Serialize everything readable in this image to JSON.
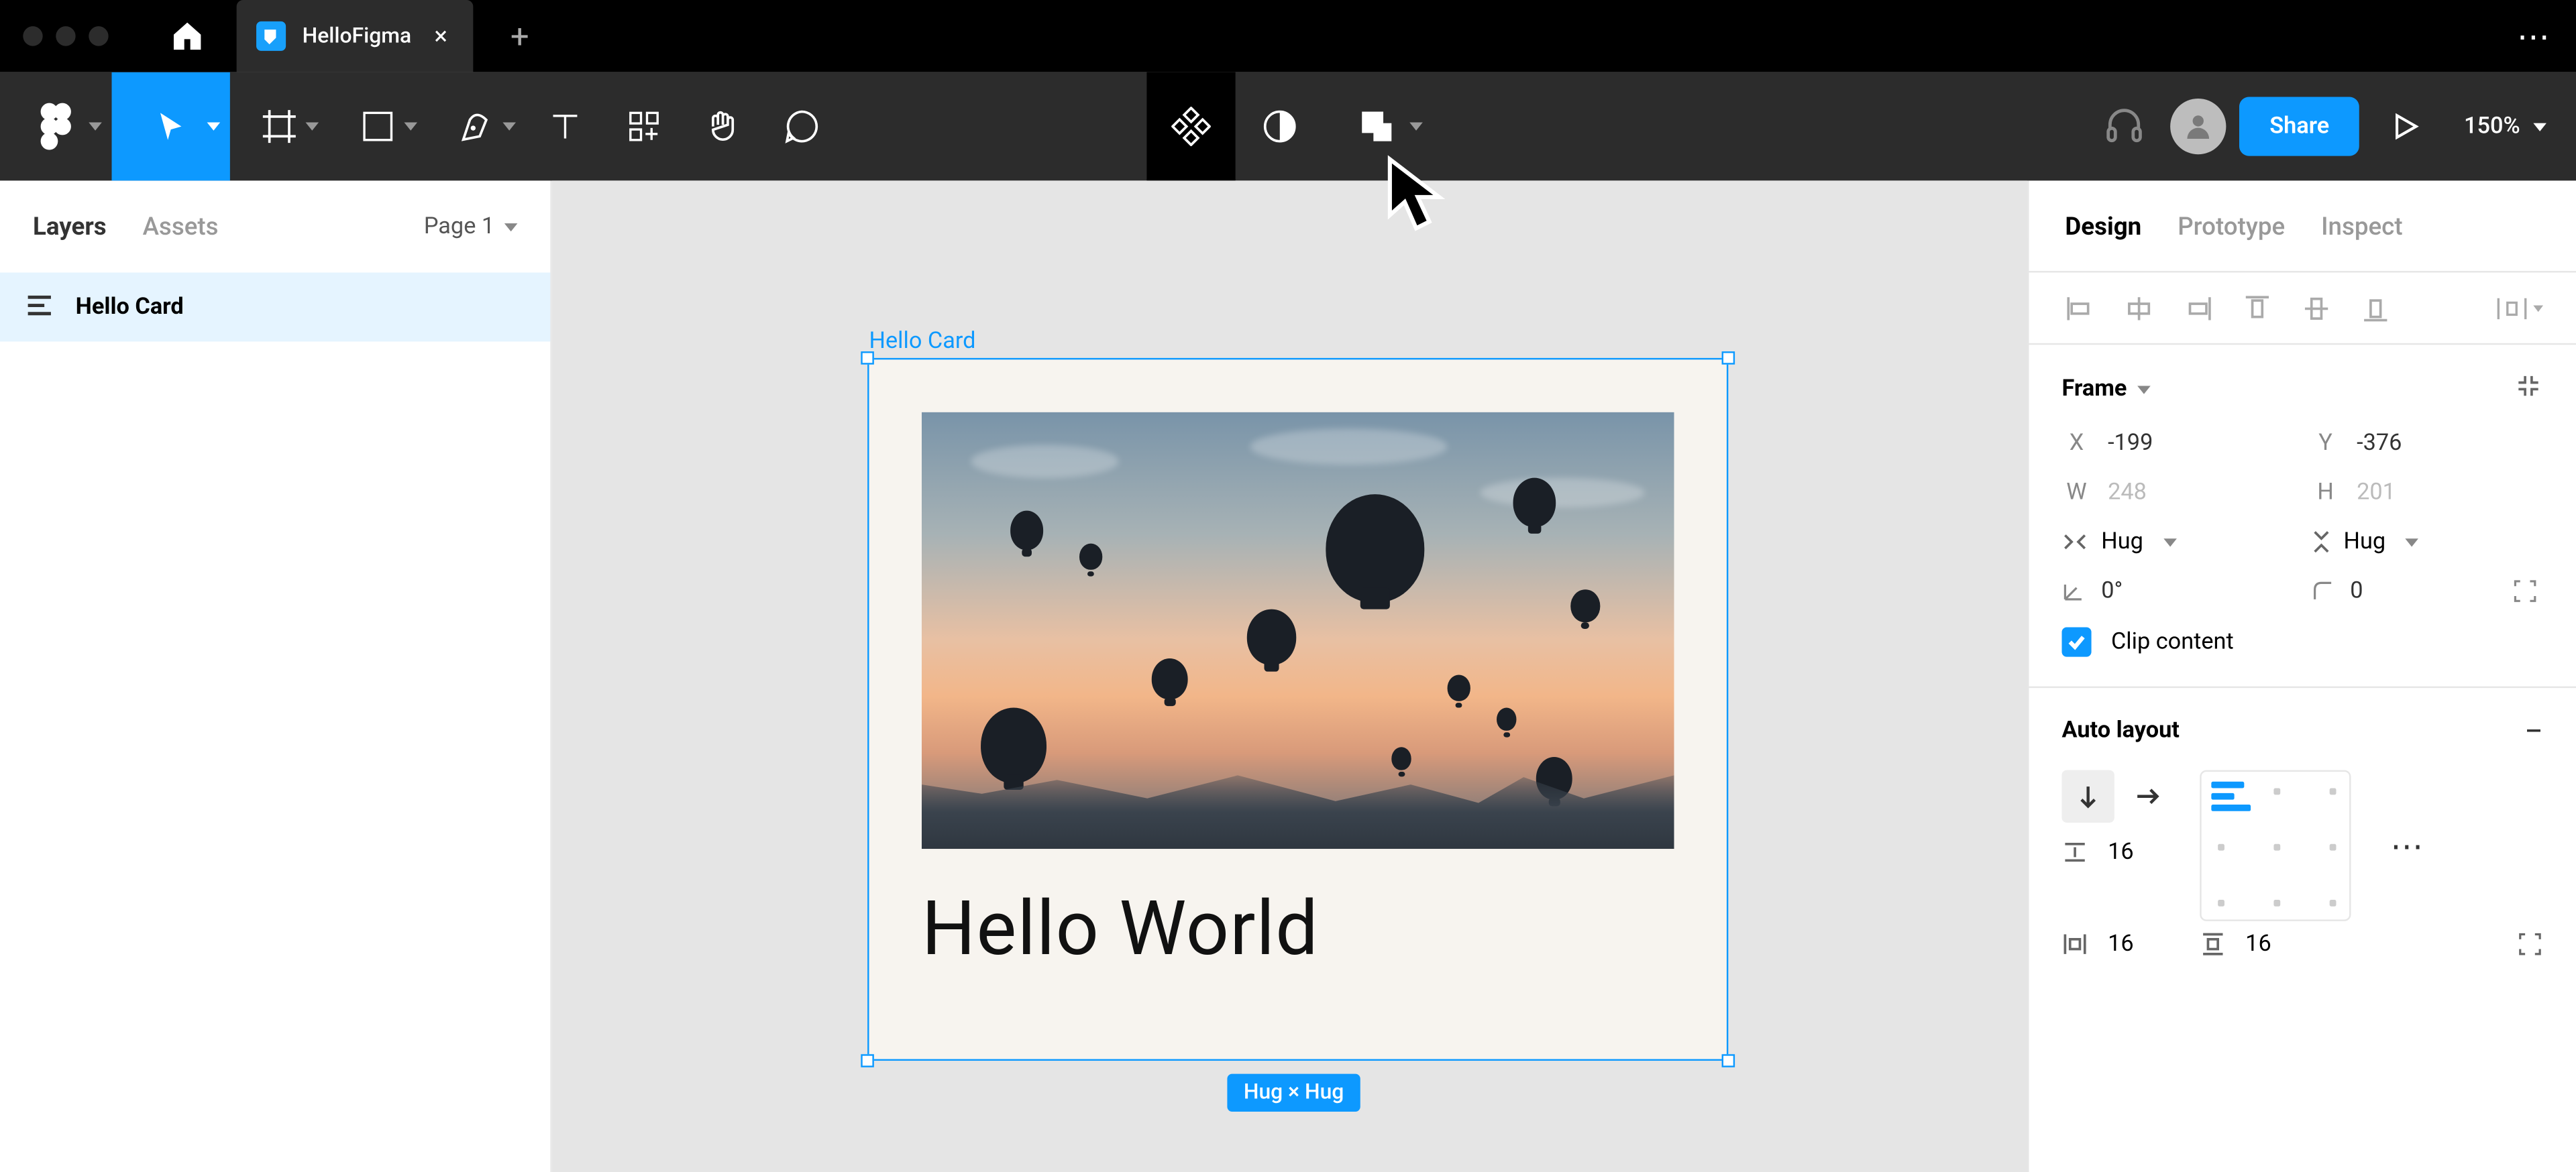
{
  "titlebar": {
    "tab_title": "HelloFigma"
  },
  "toolbar": {
    "share_label": "Share",
    "zoom": "150%"
  },
  "left_panel": {
    "tabs": {
      "layers": "Layers",
      "assets": "Assets"
    },
    "page_selector": "Page 1",
    "layers": [
      {
        "name": "Hello Card"
      }
    ]
  },
  "canvas": {
    "frame_label": "Hello Card",
    "card_text": "Hello World",
    "dimension_tag": "Hug × Hug"
  },
  "right_panel": {
    "tabs": {
      "design": "Design",
      "prototype": "Prototype",
      "inspect": "Inspect"
    },
    "frame": {
      "title": "Frame",
      "x_label": "X",
      "x_value": "-199",
      "y_label": "Y",
      "y_value": "-376",
      "w_label": "W",
      "w_value": "248",
      "h_label": "H",
      "h_value": "201",
      "hug_w": "Hug",
      "hug_h": "Hug",
      "rotation": "0°",
      "corner": "0",
      "clip_label": "Clip content"
    },
    "autolayout": {
      "title": "Auto layout",
      "item_spacing": "16",
      "pad_h": "16",
      "pad_v": "16"
    }
  }
}
